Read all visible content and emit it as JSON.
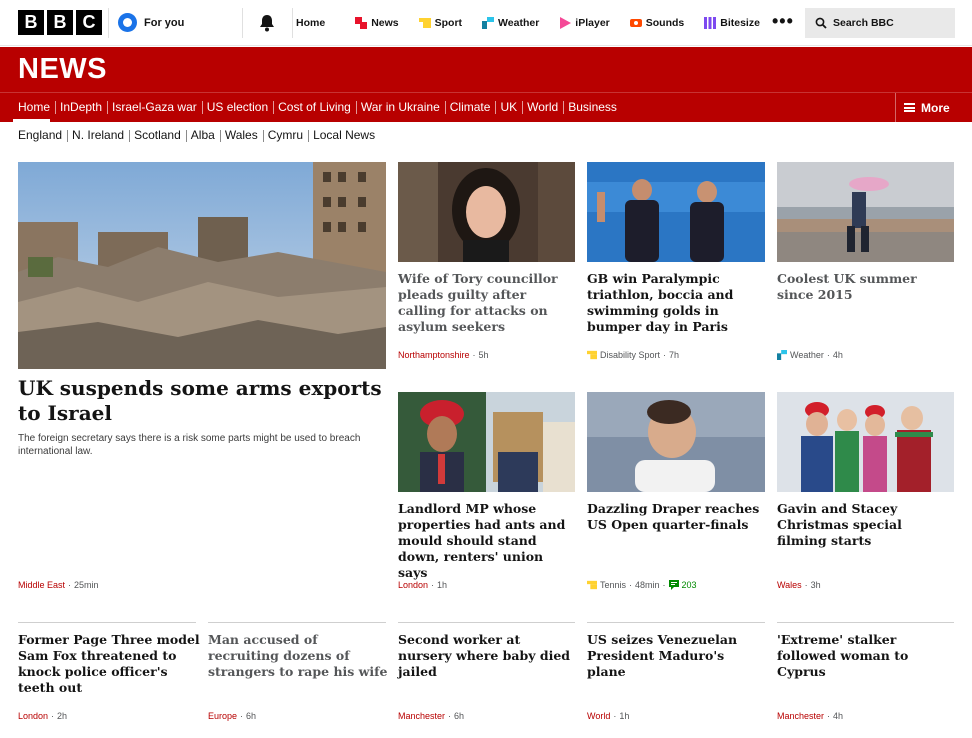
{
  "global_nav": {
    "logo_letters": [
      "B",
      "B",
      "C"
    ],
    "for_you": "For you",
    "links": [
      {
        "label": "Home",
        "icon": "none",
        "color": ""
      },
      {
        "label": "News",
        "icon": "news-icon",
        "color": "#e8132b"
      },
      {
        "label": "Sport",
        "icon": "sport-icon",
        "color": "#ffd230"
      },
      {
        "label": "Weather",
        "icon": "weather-icon",
        "color": "#1380a1"
      },
      {
        "label": "iPlayer",
        "icon": "iplayer-icon",
        "color": "#f54997"
      },
      {
        "label": "Sounds",
        "icon": "sounds-icon",
        "color": "#ff4900"
      },
      {
        "label": "Bitesize",
        "icon": "bitesize-icon",
        "color": "#7d49f0"
      }
    ],
    "more_dots": "•••",
    "search_label": "Search BBC"
  },
  "banner": {
    "wordmark": "NEWS",
    "accent": "#b80000"
  },
  "section_nav": {
    "items": [
      "Home",
      "InDepth",
      "Israel-Gaza war",
      "US election",
      "Cost of Living",
      "War in Ukraine",
      "Climate",
      "UK",
      "World",
      "Business"
    ],
    "more": "More"
  },
  "sub_nav": {
    "items": [
      "England",
      "N. Ireland",
      "Scotland",
      "Alba",
      "Wales",
      "Cymru",
      "Local News"
    ]
  },
  "lead": {
    "headline": "UK suspends some arms exports to Israel",
    "summary": "The foreign secretary says there is a risk some parts might be used to breach international law.",
    "tag": "Middle East",
    "time": "25min"
  },
  "top_row": [
    {
      "headline": "Wife of Tory councillor pleads guilty after calling for attacks on asylum seekers",
      "tag": "Northamptonshire",
      "time": "5h",
      "dim": true,
      "tag_style": "red"
    },
    {
      "headline": "GB win Paralympic triathlon, boccia and swimming golds in bumper day in Paris",
      "tag": "Disability Sport",
      "time": "7h",
      "dim": false,
      "tag_style": "sport"
    },
    {
      "headline": "Coolest UK summer since 2015",
      "tag": "Weather",
      "time": "4h",
      "dim": true,
      "tag_style": "weather"
    }
  ],
  "mid_row": [
    {
      "headline": "Landlord MP whose properties had ants and mould should stand down, renters' union says",
      "tag": "London",
      "time": "1h",
      "dim": false,
      "tag_style": "red"
    },
    {
      "headline": "Dazzling Draper reaches US Open quarter-finals",
      "tag": "Tennis",
      "time": "48min",
      "comments": "203",
      "dim": false,
      "tag_style": "sport"
    },
    {
      "headline": "Gavin and Stacey Christmas special filming starts",
      "tag": "Wales",
      "time": "3h",
      "dim": false,
      "tag_style": "red"
    }
  ],
  "bottom_row": [
    {
      "headline": "Former Page Three model Sam Fox threatened to knock police officer's teeth out",
      "tag": "London",
      "time": "2h",
      "dim": false
    },
    {
      "headline": "Man accused of recruiting dozens of strangers to rape his wife",
      "tag": "Europe",
      "time": "6h",
      "dim": true
    },
    {
      "headline": "Second worker at nursery where baby died jailed",
      "tag": "Manchester",
      "time": "6h",
      "dim": false
    },
    {
      "headline": "US seizes Venezuelan President Maduro's plane",
      "tag": "World",
      "time": "1h",
      "dim": false
    },
    {
      "headline": "'Extreme' stalker followed woman to Cyprus",
      "tag": "Manchester",
      "time": "4h",
      "dim": false
    }
  ],
  "separator": "·"
}
